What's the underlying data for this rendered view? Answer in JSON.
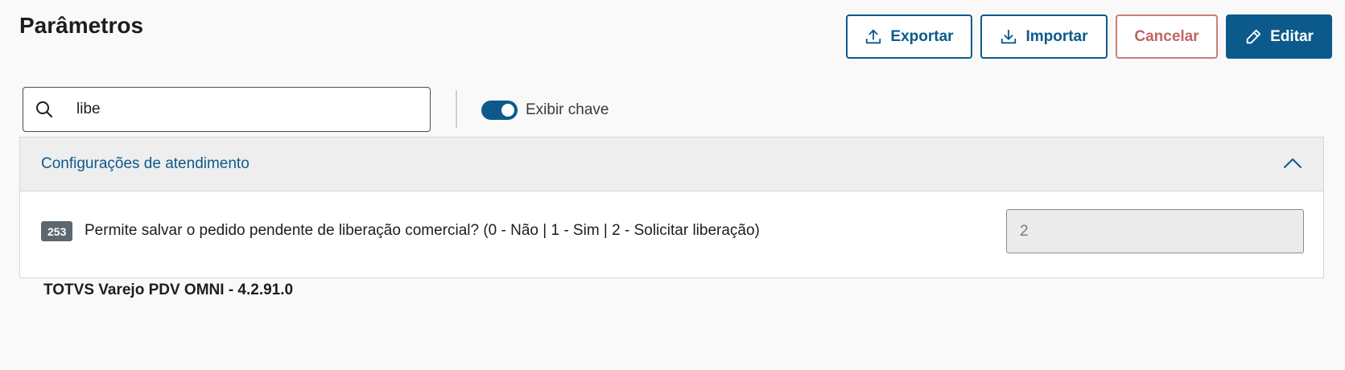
{
  "page": {
    "title": "Parâmetros"
  },
  "toolbar": {
    "export_label": "Exportar",
    "import_label": "Importar",
    "cancel_label": "Cancelar",
    "edit_label": "Editar"
  },
  "search": {
    "value": "libe",
    "icon": "search-icon"
  },
  "toggle": {
    "label": "Exibir chave",
    "checked": true
  },
  "group": {
    "title": "Configurações de atendimento",
    "expanded": true,
    "items": [
      {
        "key": "253",
        "label": "Permite salvar o pedido pendente de liberação comercial? (0 - Não | 1 - Sim | 2 - Solicitar liberação)",
        "value": "2"
      }
    ]
  },
  "footer": {
    "version": "TOTVS Varejo PDV OMNI - 4.2.91.0"
  },
  "colors": {
    "primary": "#0c5a8c",
    "danger": "#c2655f",
    "badge": "#5c6770"
  }
}
